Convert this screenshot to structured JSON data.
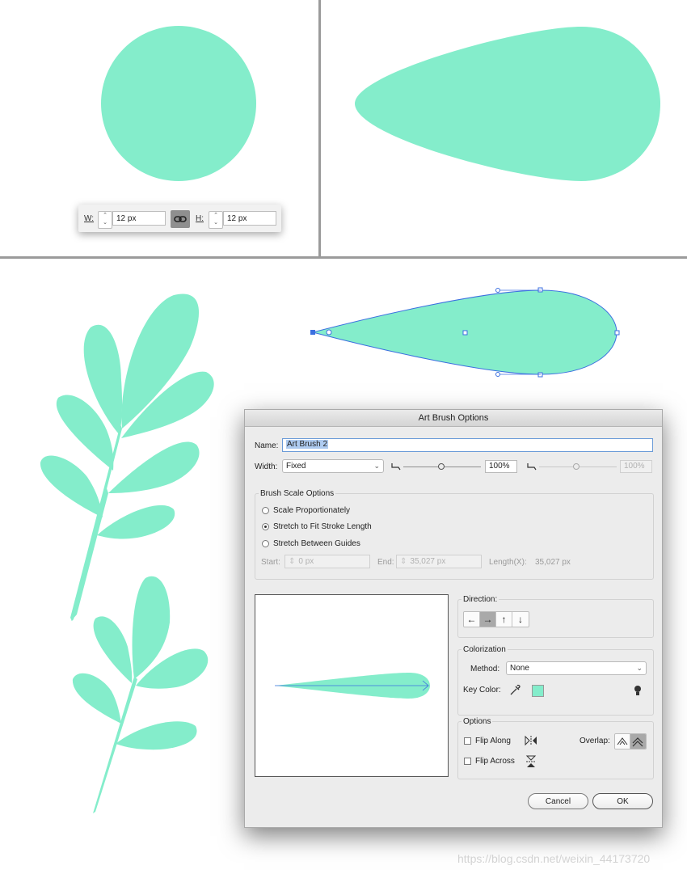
{
  "colors": {
    "shape_fill": "#84edcb",
    "path_stroke": "#3b6fe0",
    "divider": "#9b9b9b"
  },
  "size_panel": {
    "w_label": "W:",
    "w_value": "12 px",
    "h_label": "H:",
    "h_value": "12 px",
    "link_icon": "chain-link-icon"
  },
  "dialog": {
    "title": "Art Brush Options",
    "name_label": "Name:",
    "name_value": "Art Brush 2",
    "width_label": "Width:",
    "width_select": "Fixed",
    "width_percent": "100%",
    "width_percent_dim": "100%",
    "brush_scale": {
      "title": "Brush Scale Options",
      "opt_scale": "Scale Proportionately",
      "opt_stretch": "Stretch to Fit Stroke Length",
      "opt_guides": "Stretch Between Guides",
      "selected": "Stretch to Fit Stroke Length",
      "start_label": "Start:",
      "start_value": "0 px",
      "end_label": "End:",
      "end_value": "35,027 px",
      "length_label": "Length(X):",
      "length_value": "35,027 px"
    },
    "direction": {
      "title": "Direction:",
      "left": "←",
      "right": "→",
      "up": "↑",
      "down": "↓",
      "selected": "→"
    },
    "colorization": {
      "title": "Colorization",
      "method_label": "Method:",
      "method_value": "None",
      "key_color_label": "Key Color:",
      "key_color": "#84edcb"
    },
    "options": {
      "title": "Options",
      "flip_along": "Flip Along",
      "flip_across": "Flip Across",
      "overlap_label": "Overlap:"
    },
    "cancel_label": "Cancel",
    "ok_label": "OK"
  },
  "watermark": "https://blog.csdn.net/weixin_44173720"
}
